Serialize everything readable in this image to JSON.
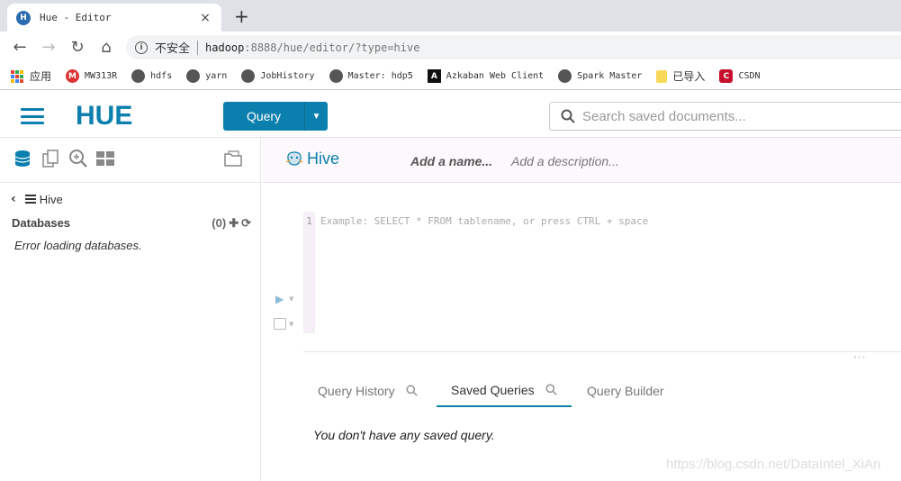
{
  "browser": {
    "tab_title": "Hue - Editor",
    "tab_close": "×",
    "new_tab": "+",
    "back": "←",
    "forward": "→",
    "reload": "↻",
    "home": "⌂",
    "insecure_label": "不安全",
    "url_host": "hadoop",
    "url_rest": ":8888/hue/editor/?type=hive",
    "bookmarks": [
      {
        "label": "应用",
        "icon": "apps-grid-icon"
      },
      {
        "label": "MW313R",
        "icon": "m-logo-icon"
      },
      {
        "label": "hdfs",
        "icon": "globe-icon"
      },
      {
        "label": "yarn",
        "icon": "globe-icon"
      },
      {
        "label": "JobHistory",
        "icon": "globe-icon"
      },
      {
        "label": "Master: hdp5",
        "icon": "globe-icon"
      },
      {
        "label": "Azkaban Web Client",
        "icon": "azkaban-icon"
      },
      {
        "label": "Spark Master",
        "icon": "globe-icon"
      },
      {
        "label": "已导入",
        "icon": "folder-icon"
      },
      {
        "label": "CSDN",
        "icon": "csdn-icon"
      }
    ]
  },
  "hue": {
    "query_button": "Query",
    "search_placeholder": "Search saved documents...",
    "left_panel": {
      "breadcrumb": "Hive",
      "databases_label": "Databases",
      "databases_count": "(0)",
      "error": "Error loading databases."
    },
    "editor": {
      "title": "Hive",
      "add_name": "Add a name...",
      "add_description": "Add a description...",
      "line_number": "1",
      "placeholder": "Example: SELECT * FROM tablename, or press CTRL + space"
    },
    "tabs": [
      {
        "label": "Query History"
      },
      {
        "label": "Saved Queries"
      },
      {
        "label": "Query Builder"
      }
    ],
    "empty_message": "You don't have any saved query.",
    "watermark": "https://blog.csdn.net/DataIntel_XiAn"
  },
  "colors": {
    "accent": "#0b7fad",
    "tab_strip": "#dee1e6"
  }
}
